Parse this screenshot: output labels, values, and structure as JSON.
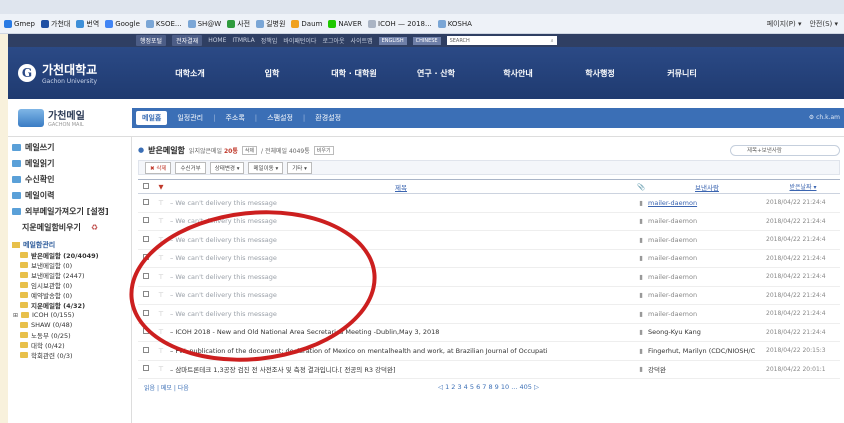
{
  "browser": {
    "favorites": [
      {
        "label": "Gmep",
        "color": "#2a7be4"
      },
      {
        "label": "가천대",
        "color": "#1e4fa3"
      },
      {
        "label": "번역",
        "color": "#3d8fd8"
      },
      {
        "label": "Google",
        "color": "#4285f4"
      },
      {
        "label": "KSOE...",
        "color": "#7aa6d6"
      },
      {
        "label": "SH@W",
        "color": "#7aa6d6"
      },
      {
        "label": "사전",
        "color": "#2e9b3e"
      },
      {
        "label": "길병원",
        "color": "#7aa6d6"
      },
      {
        "label": "Daum",
        "color": "#f0a11e"
      },
      {
        "label": "NAVER",
        "color": "#1ec800"
      },
      {
        "label": "ICOH — 2018...",
        "color": "#aab4c4"
      },
      {
        "label": "KOSHA",
        "color": "#7aa6d6"
      }
    ],
    "toolbar_right": [
      "페이지(P) ▾",
      "안전(S) ▾"
    ]
  },
  "util": {
    "items": [
      "행정포털",
      "전자결재",
      "HOME",
      "ITMRLA",
      "정책입",
      "바이패턴이다",
      "로그아웃",
      "사이트맵"
    ],
    "lang": [
      "ENGLISH",
      "CHINESE"
    ],
    "search_placeholder": "SEARCH"
  },
  "site": {
    "logo_title": "가천대학교",
    "logo_sub": "Gachon University",
    "nav": [
      "대학소개",
      "입학",
      "대학 · 대학원",
      "연구 · 산학",
      "학사안내",
      "학사행정",
      "커뮤니티"
    ]
  },
  "mail": {
    "brand": "가천메일",
    "brand_sub": "GACHON MAIL",
    "tabs": [
      "메일홈",
      "일정관리",
      "주소록",
      "스팸설정",
      "환경설정"
    ],
    "user": "⚙ ch.k.am"
  },
  "sidebar": {
    "items": [
      "메일쓰기",
      "메일읽기",
      "수신확인",
      "메일이력",
      "외부메일가져오기 [설정]",
      "지운메일함비우기"
    ],
    "tree_title": "메일함관리",
    "tree": [
      {
        "label": "받은메일함 (20/4049)",
        "bold": true
      },
      {
        "label": "보낸메일함 (0)",
        "bold": false
      },
      {
        "label": "보낸메일함 (2447)",
        "bold": false
      },
      {
        "label": "임시보관함 (0)",
        "bold": false
      },
      {
        "label": "예약발송함 (0)",
        "bold": false
      },
      {
        "label": "지운메일함 (4/32)",
        "bold": true
      },
      {
        "label": "ICOH (0/155)",
        "bold": false,
        "expand": "⊞"
      },
      {
        "label": "SHAW (0/48)",
        "bold": false
      },
      {
        "label": "노동부 (0/25)",
        "bold": false
      },
      {
        "label": "대학 (0/42)",
        "bold": false
      },
      {
        "label": "학회관련 (0/3)",
        "bold": false
      }
    ]
  },
  "mailbox": {
    "title": "받은메일함",
    "meta_prefix": "읽지않은메일",
    "unread": "20통",
    "meta_delete": "삭제",
    "meta_total": "/ 전체메일 4049통",
    "meta_empty": "비우기",
    "search_placeholder": "제목+보낸사람",
    "actions": [
      "✖ 삭제",
      "수신거부",
      "상태변경 ▾",
      "메일이동 ▾",
      "기타 ▾"
    ],
    "columns": {
      "subject": "제목",
      "sender": "보낸사람",
      "date": "받은날짜 ▾"
    },
    "rows": [
      {
        "subject": "We can't delivery this message",
        "sender": "mailer-daemon",
        "link": true,
        "date": "2018/04/22 21:24:4"
      },
      {
        "subject": "We can't delivery this message",
        "sender": "mailer-daemon",
        "link": false,
        "date": "2018/04/22 21:24:4"
      },
      {
        "subject": "We can't delivery this message",
        "sender": "mailer-daemon",
        "link": false,
        "date": "2018/04/22 21:24:4"
      },
      {
        "subject": "We can't delivery this message",
        "sender": "mailer-daemon",
        "link": false,
        "date": "2018/04/22 21:24:4"
      },
      {
        "subject": "We can't delivery this message",
        "sender": "mailer-daemon",
        "link": false,
        "date": "2018/04/22 21:24:4"
      },
      {
        "subject": "We can't delivery this message",
        "sender": "mailer-daemon",
        "link": false,
        "date": "2018/04/22 21:24:4"
      },
      {
        "subject": "We can't delivery this message",
        "sender": "mailer-daemon",
        "link": false,
        "date": "2018/04/22 21:24:4"
      },
      {
        "subject": "ICOH 2018 - New and Old National Area Secretaries Meeting -Dublin,May 3, 2018",
        "sender": "Seong-Kyu Kang",
        "link": false,
        "dark": true,
        "date": "2018/04/22 21:24:4"
      },
      {
        "subject": "FW: publication of the document: declaration of Mexico on mentalhealth and work, at Brazilian Journal of Occupati",
        "sender": "Fingerhut, Marilyn (CDC/NIOSH/C",
        "link": false,
        "dark": true,
        "date": "2018/04/22 20:15:3"
      },
      {
        "subject": "삼마트론테크 1,3공장 검진 전 사전조사 및 측정 결과입니다.[ 전공의 R3 강덕완]",
        "sender": "강덕완",
        "link": false,
        "dark": true,
        "date": "2018/04/22 20:01:1"
      }
    ],
    "pager_left": "읽음 | 메모 | 다음",
    "pages": "◁ 1 2 3 4 5 6 7 8 9 10 ... 405 ▷"
  },
  "colors": {
    "annotation": "#cc1f1f",
    "brand": "#2b4a86",
    "tab": "#3b6fb6"
  }
}
